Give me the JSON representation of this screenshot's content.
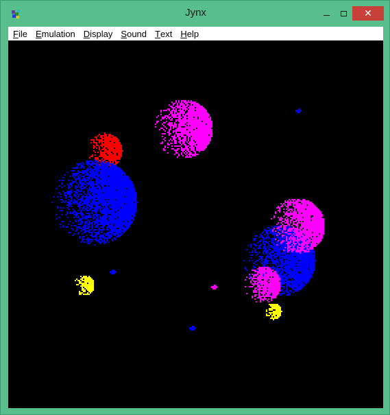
{
  "window": {
    "title": "Jynx"
  },
  "menu": [
    {
      "label": "File",
      "mnemonic": "F",
      "rest": "ile"
    },
    {
      "label": "Emulation",
      "mnemonic": "E",
      "rest": "mulation"
    },
    {
      "label": "Display",
      "mnemonic": "D",
      "rest": "isplay"
    },
    {
      "label": "Sound",
      "mnemonic": "S",
      "rest": "ound"
    },
    {
      "label": "Text",
      "mnemonic": "T",
      "rest": "ext"
    },
    {
      "label": "Help",
      "mnemonic": "H",
      "rest": "elp"
    }
  ],
  "controls": {
    "minimize_icon": "minimize-icon",
    "maximize_icon": "maximize-icon",
    "close_icon": "close-icon",
    "close_glyph": "✕"
  },
  "colors": {
    "frame": "#57be8c",
    "close_button": "#c7413a",
    "screen_background": "#000000",
    "blue": "#0000ff",
    "red": "#ff0000",
    "magenta": "#ff00ff",
    "yellow": "#ffff00"
  }
}
